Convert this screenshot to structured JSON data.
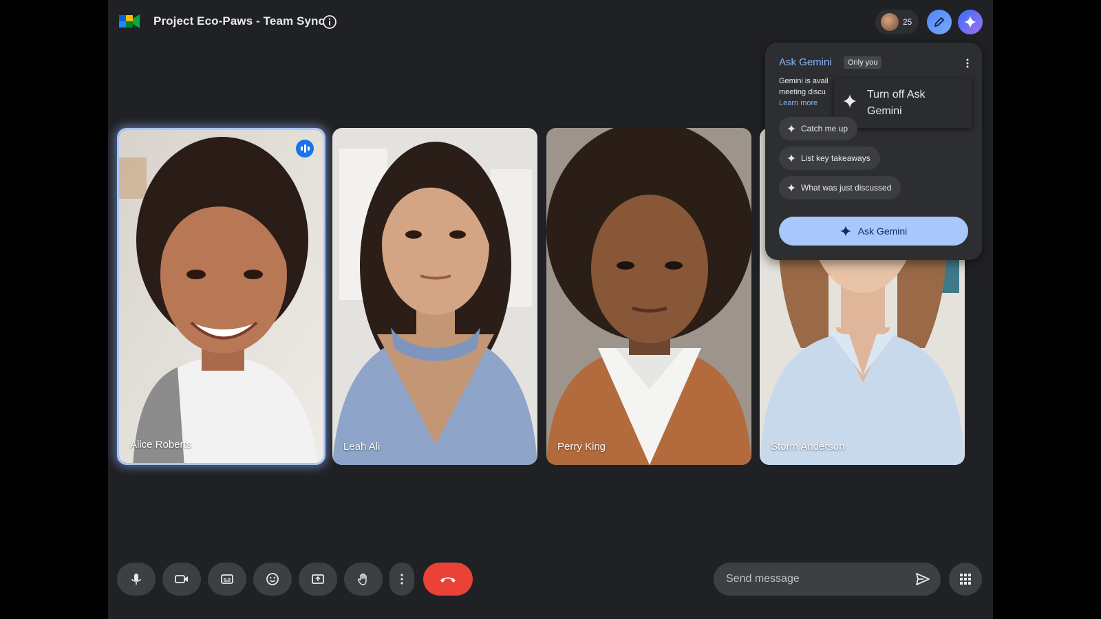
{
  "meeting": {
    "title": "Project Eco-Paws - Team Sync"
  },
  "header": {
    "participant_count": "25"
  },
  "participants": [
    {
      "name": "Alice Roberts",
      "speaking": true
    },
    {
      "name": "Leah Ali",
      "speaking": false
    },
    {
      "name": "Perry King",
      "speaking": false
    },
    {
      "name": "Storm Anderson",
      "speaking": false
    }
  ],
  "gemini_panel": {
    "title": "Ask Gemini",
    "badge": "Only you",
    "description_line1": "Gemini is avail",
    "description_line2": "meeting discu",
    "learn_more": "Learn more",
    "menu_item": "Turn off Ask Gemini",
    "suggestions": [
      "Catch me up",
      "List key takeaways",
      "What was just discussed"
    ],
    "ask_button": "Ask Gemini"
  },
  "chat": {
    "placeholder": "Send message"
  },
  "colors": {
    "accent": "#a8c7fa",
    "end_call": "#ea4335",
    "link": "#8ab4f8"
  }
}
